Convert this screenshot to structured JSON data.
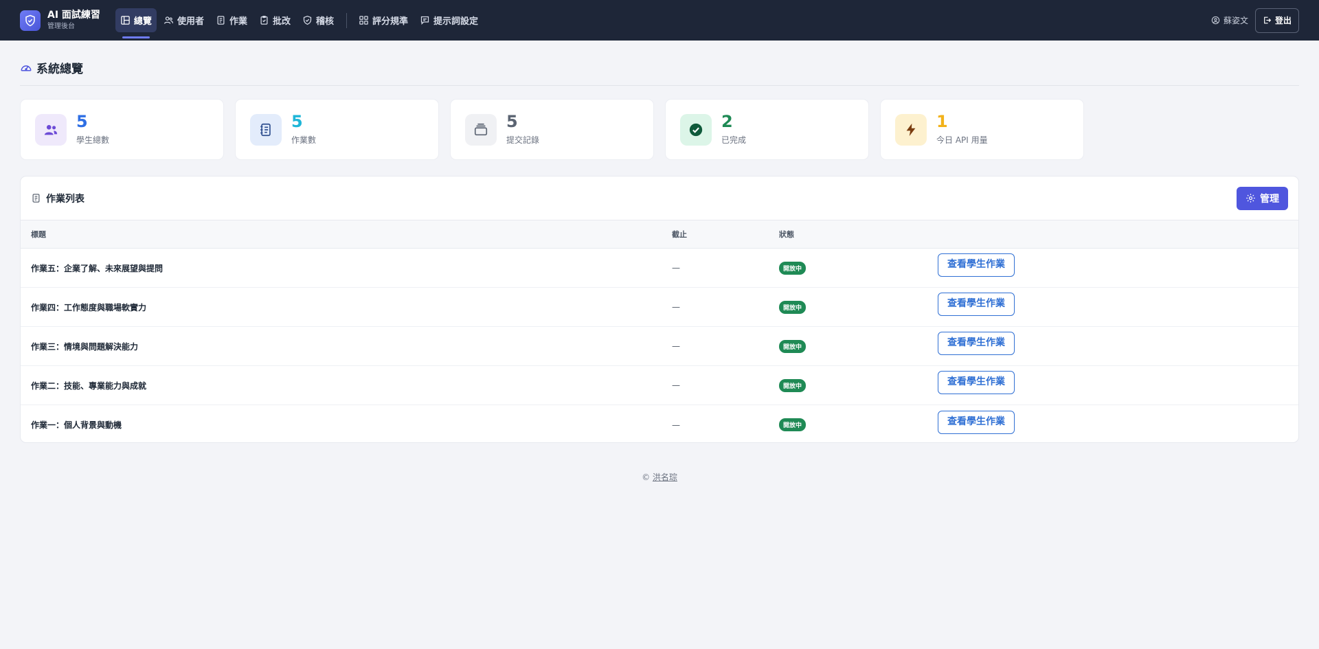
{
  "brand": {
    "title": "AI 面試練習",
    "subtitle": "管理後台"
  },
  "nav": {
    "items": [
      {
        "label": "總覽",
        "icon": "layout-icon",
        "active": true
      },
      {
        "label": "使用者",
        "icon": "users-icon"
      },
      {
        "label": "作業",
        "icon": "document-icon"
      },
      {
        "label": "批改",
        "icon": "clipboard-check-icon"
      },
      {
        "label": "稽核",
        "icon": "shield-check-icon"
      },
      {
        "label": "評分規準",
        "icon": "grid-icon"
      },
      {
        "label": "提示詞設定",
        "icon": "chat-icon"
      }
    ],
    "user_name": "蘇姿文",
    "logout_label": "登出"
  },
  "page": {
    "title": "系統總覽"
  },
  "stats": [
    {
      "value": "5",
      "label": "學生總數",
      "icon": "users-icon",
      "color": "#2f6fe4",
      "bg": "#efe9fb"
    },
    {
      "value": "5",
      "label": "作業數",
      "icon": "journal-icon",
      "color": "#1fb6d8",
      "bg": "#e3ecfb"
    },
    {
      "value": "5",
      "label": "提交記錄",
      "icon": "stack-icon",
      "color": "#5b6472",
      "bg": "#f0f1f4"
    },
    {
      "value": "2",
      "label": "已完成",
      "icon": "check-circle-icon",
      "color": "#1f8a55",
      "bg": "#dcf5e8"
    },
    {
      "value": "1",
      "label": "今日 API 用量",
      "icon": "lightning-icon",
      "color": "#f2b21b",
      "bg": "#fdf1cf"
    }
  ],
  "assignments": {
    "title": "作業列表",
    "manage_label": "管理",
    "columns": {
      "title": "標題",
      "due": "截止",
      "status": "狀態"
    },
    "rows": [
      {
        "title": "作業五：企業了解、未來展望與提問",
        "due": "—",
        "status": "開放中",
        "action": "查看學生作業"
      },
      {
        "title": "作業四：工作態度與職場軟實力",
        "due": "—",
        "status": "開放中",
        "action": "查看學生作業"
      },
      {
        "title": "作業三：情境與問題解決能力",
        "due": "—",
        "status": "開放中",
        "action": "查看學生作業"
      },
      {
        "title": "作業二：技能、專業能力與成就",
        "due": "—",
        "status": "開放中",
        "action": "查看學生作業"
      },
      {
        "title": "作業一：個人背景與動機",
        "due": "—",
        "status": "開放中",
        "action": "查看學生作業"
      }
    ]
  },
  "footer": {
    "copyright": "©",
    "author": "洪名琮"
  }
}
